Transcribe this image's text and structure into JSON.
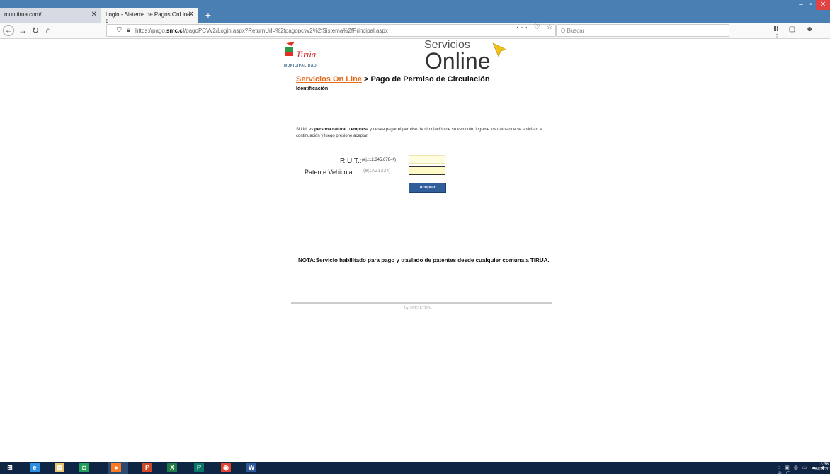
{
  "browser": {
    "tabs": [
      {
        "label": "munitirua.com/",
        "active": false
      },
      {
        "label": "Login - Sistema de Pagos OnLine d",
        "active": true
      }
    ],
    "new_tab": "+",
    "close_glyph": "✕",
    "url_prefix": "https://pago.",
    "url_domain": "smc.cl",
    "url_rest": "/pagoPCVv2/Login.aspx?ReturnUrl=%2fpagopcvv2%2fSistema%2fPrincipal.aspx",
    "page_actions": "··· ♡ ☆",
    "search_placeholder": "Q Buscar",
    "tools": "Ⅲ ▢ ☻ ⋮"
  },
  "page": {
    "logo_name": "Tirúa",
    "logo_sub": "MUNICIPALIDAD",
    "header_small": "Servicios",
    "header_big": "Online",
    "crumb_link": "Servicios On Line",
    "crumb_rest": " > Pago de Permiso de Circulación",
    "section": "Identificación",
    "intro_1": "Si Ud. es ",
    "intro_bold_1": "persona natural",
    "intro_2": " o ",
    "intro_bold_2": "empresa",
    "intro_3": " y desea pagar el permiso de circulación de su vehículo, ingrese los datos que se solicitan a continuación y luego presione aceptar.",
    "rut_label": "R.U.T.:",
    "rut_example": "(ej.:12.345.678-K)",
    "rut_value": "",
    "patente_label": "Patente Vehicular:",
    "patente_example": "(ej.:AZ1234)",
    "patente_value": "",
    "accept_button": "Aceptar",
    "nota": "NOTA:Servicio habilitado para pago y traslado de patentes desde cualquier comuna a TIRUA.",
    "footer": "by SMC LTDA."
  },
  "taskbar": {
    "apps": [
      {
        "icon": "windows-start-icon",
        "glyph": "⊞",
        "color": "#ffffff"
      },
      {
        "icon": "internet-explorer-icon",
        "glyph": "e",
        "color": "#2f8ee0"
      },
      {
        "icon": "file-explorer-icon",
        "glyph": "▤",
        "color": "#e9c46a"
      },
      {
        "icon": "store-icon",
        "glyph": "◘",
        "color": "#1f9e57"
      },
      {
        "icon": "firefox-icon",
        "glyph": "●",
        "color": "#ff7b23"
      },
      {
        "icon": "powerpoint-icon",
        "glyph": "P",
        "color": "#d24726"
      },
      {
        "icon": "excel-icon",
        "glyph": "X",
        "color": "#1e7b45"
      },
      {
        "icon": "publisher-icon",
        "glyph": "P",
        "color": "#077568"
      },
      {
        "icon": "chrome-icon",
        "glyph": "◉",
        "color": "#e3442f"
      },
      {
        "icon": "word-icon",
        "glyph": "W",
        "color": "#2b579a"
      }
    ],
    "tray": "⌂ ▣ ◍ ▭ ☁ ◀ ⊘ ▢",
    "time": "13:38",
    "date": "26/03/202"
  }
}
